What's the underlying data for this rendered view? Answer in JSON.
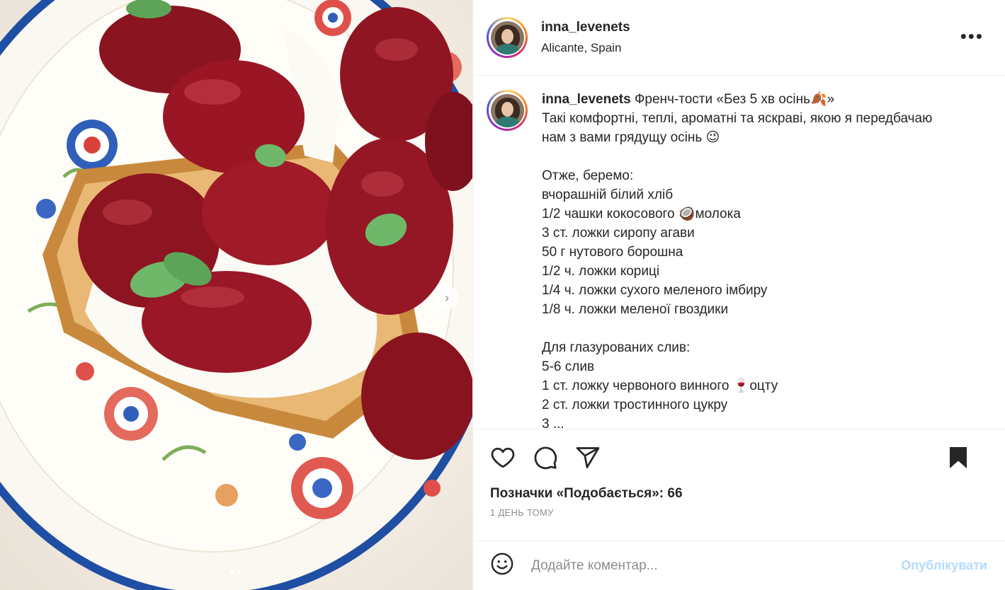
{
  "post": {
    "username": "inna_levenets",
    "location": "Alicante, Spain",
    "caption": {
      "title": "Френч-тости «Без 5 хв осінь🍂»",
      "lines": [
        "Такі комфортні, теплі, ароматні та яскраві, якою я передбачаю",
        "нам з вами грядущу осінь 😉",
        "",
        "Отже, беремо:",
        "вчорашній білий хліб",
        "1/2 чашки кокосового 🥥молока",
        "3 ст. ложки сиропу агави",
        "50 г нутового борошна",
        "1/2 ч. ложки кориці",
        "1/4 ч. ложки сухого меленого імбиру",
        "1/8 ч. ложки меленої гвоздики",
        "",
        "Для глазурованих слив:",
        "5-6 слив",
        "1 ст. ложку червоного винного 🍷оцту",
        "2 ст. ложки тростинного цукру",
        "3 ..."
      ]
    },
    "likes_text": "Позначки «Подобається»: 66",
    "time_text": "1 ДЕНЬ ТОМУ"
  },
  "icons": {
    "more": "more-options-icon",
    "like": "heart-icon",
    "comment": "comment-icon",
    "share": "share-icon",
    "save": "bookmark-icon",
    "emoji": "emoji-icon",
    "next": "chevron-right-icon"
  },
  "comment": {
    "placeholder": "Додайте коментар...",
    "post_label": "Опублікувати"
  },
  "carousel": {
    "count": 2,
    "active": 1
  },
  "colors": {
    "text": "#262626",
    "secondary": "#8e8e8e",
    "link_disabled": "#b3dbff",
    "border": "#efefef"
  }
}
